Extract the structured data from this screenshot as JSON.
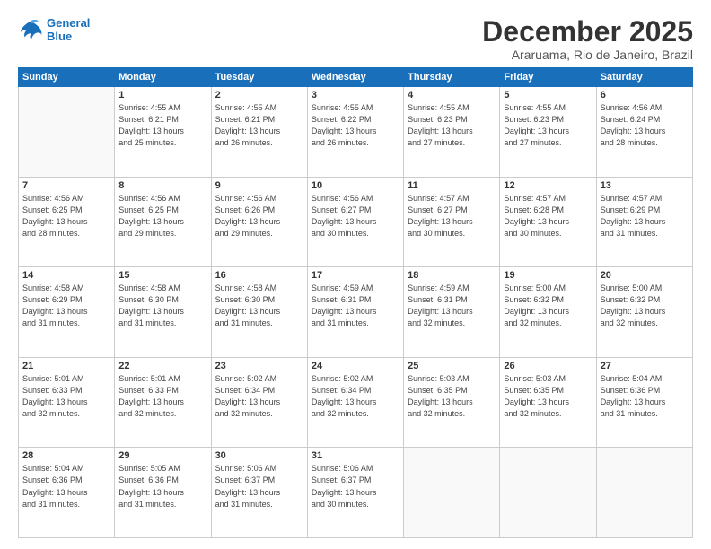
{
  "logo": {
    "line1": "General",
    "line2": "Blue"
  },
  "title": "December 2025",
  "subtitle": "Araruama, Rio de Janeiro, Brazil",
  "days_of_week": [
    "Sunday",
    "Monday",
    "Tuesday",
    "Wednesday",
    "Thursday",
    "Friday",
    "Saturday"
  ],
  "weeks": [
    [
      {
        "num": "",
        "info": ""
      },
      {
        "num": "1",
        "info": "Sunrise: 4:55 AM\nSunset: 6:21 PM\nDaylight: 13 hours\nand 25 minutes."
      },
      {
        "num": "2",
        "info": "Sunrise: 4:55 AM\nSunset: 6:21 PM\nDaylight: 13 hours\nand 26 minutes."
      },
      {
        "num": "3",
        "info": "Sunrise: 4:55 AM\nSunset: 6:22 PM\nDaylight: 13 hours\nand 26 minutes."
      },
      {
        "num": "4",
        "info": "Sunrise: 4:55 AM\nSunset: 6:23 PM\nDaylight: 13 hours\nand 27 minutes."
      },
      {
        "num": "5",
        "info": "Sunrise: 4:55 AM\nSunset: 6:23 PM\nDaylight: 13 hours\nand 27 minutes."
      },
      {
        "num": "6",
        "info": "Sunrise: 4:56 AM\nSunset: 6:24 PM\nDaylight: 13 hours\nand 28 minutes."
      }
    ],
    [
      {
        "num": "7",
        "info": "Sunrise: 4:56 AM\nSunset: 6:25 PM\nDaylight: 13 hours\nand 28 minutes."
      },
      {
        "num": "8",
        "info": "Sunrise: 4:56 AM\nSunset: 6:25 PM\nDaylight: 13 hours\nand 29 minutes."
      },
      {
        "num": "9",
        "info": "Sunrise: 4:56 AM\nSunset: 6:26 PM\nDaylight: 13 hours\nand 29 minutes."
      },
      {
        "num": "10",
        "info": "Sunrise: 4:56 AM\nSunset: 6:27 PM\nDaylight: 13 hours\nand 30 minutes."
      },
      {
        "num": "11",
        "info": "Sunrise: 4:57 AM\nSunset: 6:27 PM\nDaylight: 13 hours\nand 30 minutes."
      },
      {
        "num": "12",
        "info": "Sunrise: 4:57 AM\nSunset: 6:28 PM\nDaylight: 13 hours\nand 30 minutes."
      },
      {
        "num": "13",
        "info": "Sunrise: 4:57 AM\nSunset: 6:29 PM\nDaylight: 13 hours\nand 31 minutes."
      }
    ],
    [
      {
        "num": "14",
        "info": "Sunrise: 4:58 AM\nSunset: 6:29 PM\nDaylight: 13 hours\nand 31 minutes."
      },
      {
        "num": "15",
        "info": "Sunrise: 4:58 AM\nSunset: 6:30 PM\nDaylight: 13 hours\nand 31 minutes."
      },
      {
        "num": "16",
        "info": "Sunrise: 4:58 AM\nSunset: 6:30 PM\nDaylight: 13 hours\nand 31 minutes."
      },
      {
        "num": "17",
        "info": "Sunrise: 4:59 AM\nSunset: 6:31 PM\nDaylight: 13 hours\nand 31 minutes."
      },
      {
        "num": "18",
        "info": "Sunrise: 4:59 AM\nSunset: 6:31 PM\nDaylight: 13 hours\nand 32 minutes."
      },
      {
        "num": "19",
        "info": "Sunrise: 5:00 AM\nSunset: 6:32 PM\nDaylight: 13 hours\nand 32 minutes."
      },
      {
        "num": "20",
        "info": "Sunrise: 5:00 AM\nSunset: 6:32 PM\nDaylight: 13 hours\nand 32 minutes."
      }
    ],
    [
      {
        "num": "21",
        "info": "Sunrise: 5:01 AM\nSunset: 6:33 PM\nDaylight: 13 hours\nand 32 minutes."
      },
      {
        "num": "22",
        "info": "Sunrise: 5:01 AM\nSunset: 6:33 PM\nDaylight: 13 hours\nand 32 minutes."
      },
      {
        "num": "23",
        "info": "Sunrise: 5:02 AM\nSunset: 6:34 PM\nDaylight: 13 hours\nand 32 minutes."
      },
      {
        "num": "24",
        "info": "Sunrise: 5:02 AM\nSunset: 6:34 PM\nDaylight: 13 hours\nand 32 minutes."
      },
      {
        "num": "25",
        "info": "Sunrise: 5:03 AM\nSunset: 6:35 PM\nDaylight: 13 hours\nand 32 minutes."
      },
      {
        "num": "26",
        "info": "Sunrise: 5:03 AM\nSunset: 6:35 PM\nDaylight: 13 hours\nand 32 minutes."
      },
      {
        "num": "27",
        "info": "Sunrise: 5:04 AM\nSunset: 6:36 PM\nDaylight: 13 hours\nand 31 minutes."
      }
    ],
    [
      {
        "num": "28",
        "info": "Sunrise: 5:04 AM\nSunset: 6:36 PM\nDaylight: 13 hours\nand 31 minutes."
      },
      {
        "num": "29",
        "info": "Sunrise: 5:05 AM\nSunset: 6:36 PM\nDaylight: 13 hours\nand 31 minutes."
      },
      {
        "num": "30",
        "info": "Sunrise: 5:06 AM\nSunset: 6:37 PM\nDaylight: 13 hours\nand 31 minutes."
      },
      {
        "num": "31",
        "info": "Sunrise: 5:06 AM\nSunset: 6:37 PM\nDaylight: 13 hours\nand 30 minutes."
      },
      {
        "num": "",
        "info": ""
      },
      {
        "num": "",
        "info": ""
      },
      {
        "num": "",
        "info": ""
      }
    ]
  ]
}
